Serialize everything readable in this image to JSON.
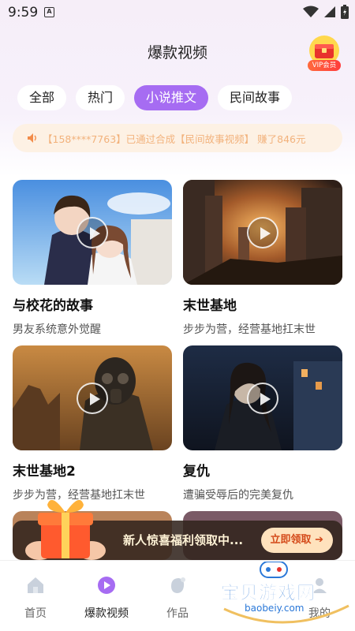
{
  "status_bar": {
    "time": "9:59",
    "a_icon": "A"
  },
  "header": {
    "title": "爆款视频",
    "vip_label": "VIP会员"
  },
  "tabs": [
    {
      "label": "全部",
      "active": false
    },
    {
      "label": "热门",
      "active": false
    },
    {
      "label": "小说推文",
      "active": true
    },
    {
      "label": "民间故事",
      "active": false
    }
  ],
  "notice": {
    "text": "【158****7763】已通过合成【民间故事视频】 赚了846元",
    "icon": "speaker-icon"
  },
  "cards": [
    {
      "title": "与校花的故事",
      "subtitle": "男友系统意外觉醒"
    },
    {
      "title": "末世基地",
      "subtitle": "步步为营，经营基地扛末世"
    },
    {
      "title": "末世基地2",
      "subtitle": "步步为营，经营基地扛末世"
    },
    {
      "title": "复仇",
      "subtitle": "遭骗受辱后的完美复仇"
    }
  ],
  "promo": {
    "text": "新人惊喜福利领取中...",
    "button": "立即领取"
  },
  "nav": [
    {
      "label": "首页",
      "icon": "home-icon"
    },
    {
      "label": "爆款视频",
      "icon": "video-icon"
    },
    {
      "label": "作品",
      "icon": "works-icon"
    },
    {
      "label": "我的",
      "icon": "profile-icon"
    }
  ],
  "watermark": {
    "text": "宝贝游戏网",
    "url": "baobeiy.com"
  },
  "colors": {
    "accent": "#a66cf2",
    "notice_bg": "#fdf1e4",
    "notice_text": "#f2b27c",
    "promo_btn": "#ffe2bd"
  }
}
